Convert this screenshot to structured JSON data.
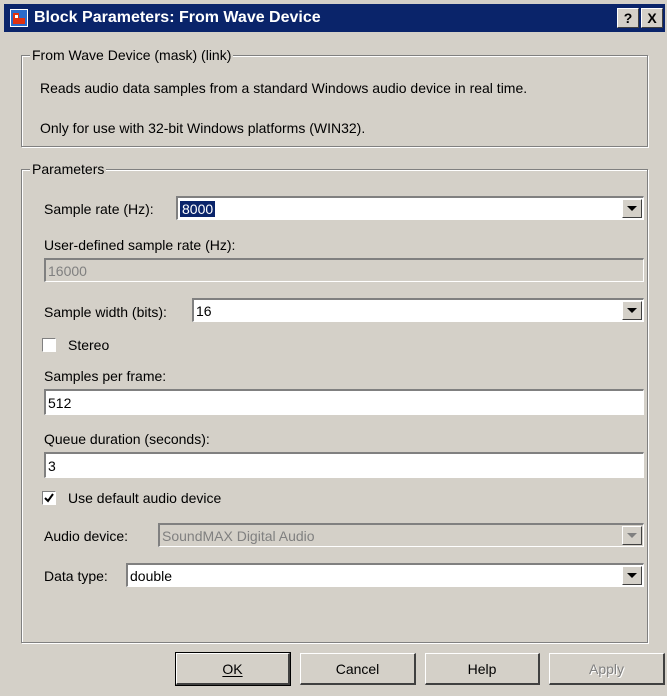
{
  "window": {
    "title": "Block Parameters: From Wave Device"
  },
  "titlebar_buttons": {
    "help": "?",
    "close": "X"
  },
  "mask_group": {
    "title": "From Wave Device (mask) (link)",
    "description1": "Reads audio data samples from a standard Windows audio device in real time.",
    "description2": "Only for use with 32-bit Windows platforms (WIN32)."
  },
  "params": {
    "title": "Parameters",
    "sample_rate": {
      "label": "Sample rate (Hz):",
      "value": "8000"
    },
    "user_rate": {
      "label": "User-defined sample rate (Hz):",
      "value": "16000"
    },
    "sample_width": {
      "label": "Sample width (bits):",
      "value": "16"
    },
    "stereo": {
      "label": "Stereo",
      "checked": false
    },
    "samples_per_frame": {
      "label": "Samples per frame:",
      "value": "512"
    },
    "queue_duration": {
      "label": "Queue duration (seconds):",
      "value": "3"
    },
    "use_default": {
      "label": "Use default audio device",
      "checked": true
    },
    "audio_device": {
      "label": "Audio device:",
      "value": "SoundMAX Digital Audio"
    },
    "data_type": {
      "label": "Data type:",
      "value": "double"
    }
  },
  "buttons": {
    "ok": "OK",
    "cancel": "Cancel",
    "help": "Help",
    "apply": "Apply"
  },
  "colors": {
    "titlebar": "#0a246a",
    "face": "#d4d0c8"
  }
}
